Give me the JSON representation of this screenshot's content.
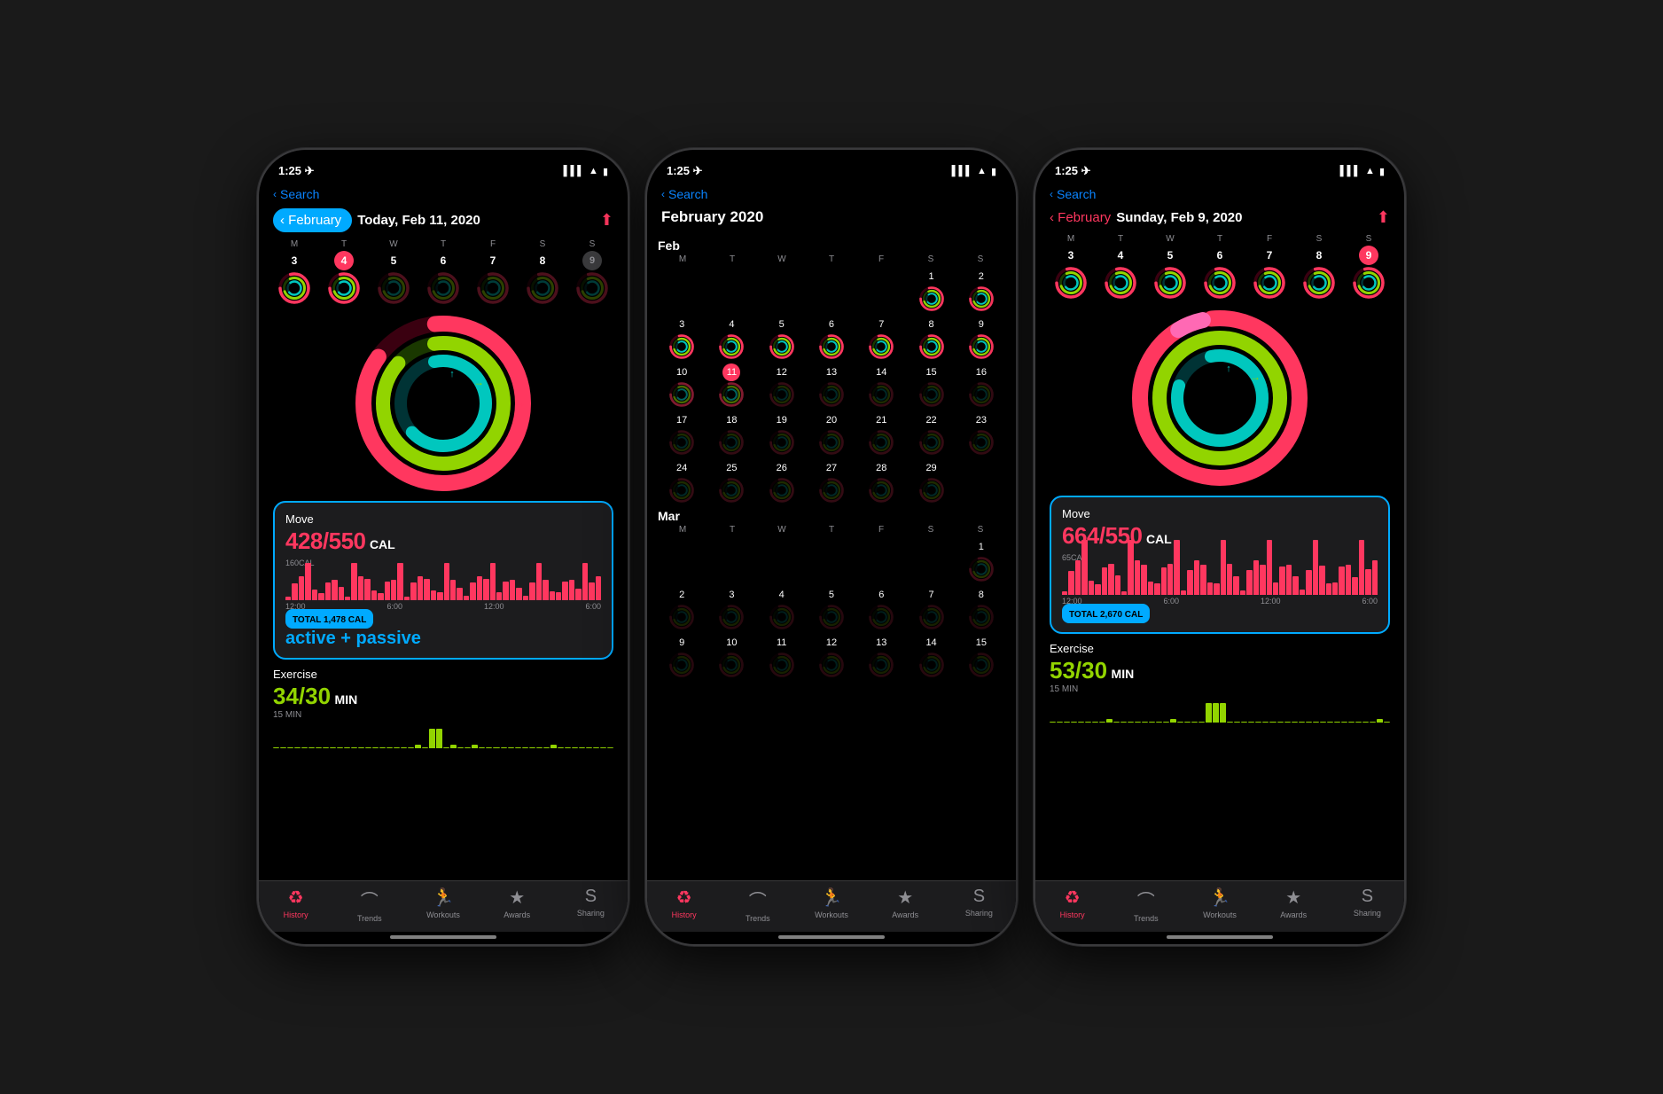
{
  "phones": [
    {
      "id": "phone1",
      "status": {
        "time": "1:25",
        "signal": "▌▌▌",
        "wifi": "WiFi",
        "battery": "🔋"
      },
      "search": "Search",
      "nav": {
        "back": "February",
        "back_highlighted": true,
        "title": "Today, Feb 11, 2020",
        "share": true
      },
      "week_days": [
        "M",
        "T",
        "W",
        "T",
        "F",
        "S",
        "S"
      ],
      "week_nums": [
        "3",
        "4",
        "5",
        "6",
        "7",
        "8",
        "9"
      ],
      "today_index": 1,
      "type": "daily",
      "move": {
        "label": "Move",
        "value": "428/550",
        "unit": "CAL",
        "chart_label": "160CAL",
        "times": [
          "12:00",
          "6:00",
          "12:00",
          "6:00"
        ],
        "total": "TOTAL 1,478 CAL",
        "annotation": "active + passive"
      },
      "exercise": {
        "label": "Exercise",
        "value": "34/30",
        "unit": "MIN",
        "chart_label": "15 MIN"
      },
      "tabs": [
        "History",
        "Trends",
        "Workouts",
        "Awards",
        "Sharing"
      ],
      "active_tab": 0
    },
    {
      "id": "phone2",
      "status": {
        "time": "1:25",
        "signal": "▌▌▌",
        "wifi": "WiFi",
        "battery": "🔋"
      },
      "search": "Search",
      "nav": {
        "back": null,
        "title": "February 2020",
        "share": false
      },
      "type": "calendar",
      "cal_months": [
        {
          "name": "Feb",
          "headers": [
            "M",
            "T",
            "W",
            "T",
            "F",
            "S",
            "S"
          ],
          "weeks": [
            [
              "",
              "",
              "",
              "",
              "",
              "1",
              "2"
            ],
            [
              "3",
              "4",
              "5",
              "6",
              "7",
              "8",
              "9"
            ],
            [
              "10",
              "11",
              "12",
              "13",
              "14",
              "15",
              "16"
            ],
            [
              "17",
              "18",
              "19",
              "20",
              "21",
              "22",
              "23"
            ],
            [
              "24",
              "25",
              "26",
              "27",
              "28",
              "29",
              ""
            ]
          ],
          "today": "11"
        },
        {
          "name": "Mar",
          "headers": [
            "M",
            "T",
            "W",
            "T",
            "F",
            "S",
            "S"
          ],
          "weeks": [
            [
              "",
              "",
              "",
              "",
              "",
              "",
              "1"
            ],
            [
              "2",
              "3",
              "4",
              "5",
              "6",
              "7",
              "8"
            ],
            [
              "9",
              "10",
              "11",
              "12",
              "13",
              "14",
              "15"
            ]
          ],
          "today": null
        }
      ],
      "tabs": [
        "History",
        "Trends",
        "Workouts",
        "Awards",
        "Sharing"
      ],
      "active_tab": 0
    },
    {
      "id": "phone3",
      "status": {
        "time": "1:25",
        "signal": "▌▌▌",
        "wifi": "WiFi",
        "battery": "🔋"
      },
      "search": "Search",
      "nav": {
        "back": "February",
        "back_highlighted": false,
        "title": "Sunday, Feb 9, 2020",
        "share": true
      },
      "week_days": [
        "M",
        "T",
        "W",
        "T",
        "F",
        "S",
        "S"
      ],
      "week_nums": [
        "3",
        "4",
        "5",
        "6",
        "7",
        "8",
        "9"
      ],
      "today_index": 6,
      "type": "daily",
      "move": {
        "label": "Move",
        "value": "664/550",
        "unit": "CAL",
        "chart_label": "65CAL",
        "times": [
          "12:00",
          "6:00",
          "12:00",
          "6:00"
        ],
        "total": "TOTAL 2,670 CAL",
        "annotation": null
      },
      "exercise": {
        "label": "Exercise",
        "value": "53/30",
        "unit": "MIN",
        "chart_label": "15 MIN"
      },
      "tabs": [
        "History",
        "Trends",
        "Workouts",
        "Awards",
        "Sharing"
      ],
      "active_tab": 0
    }
  ],
  "tab_icons": [
    "♻",
    "⌃",
    "🏃",
    "★",
    "S"
  ],
  "tab_icon_labels": [
    "History",
    "Trends",
    "Workouts",
    "Awards",
    "Sharing"
  ]
}
